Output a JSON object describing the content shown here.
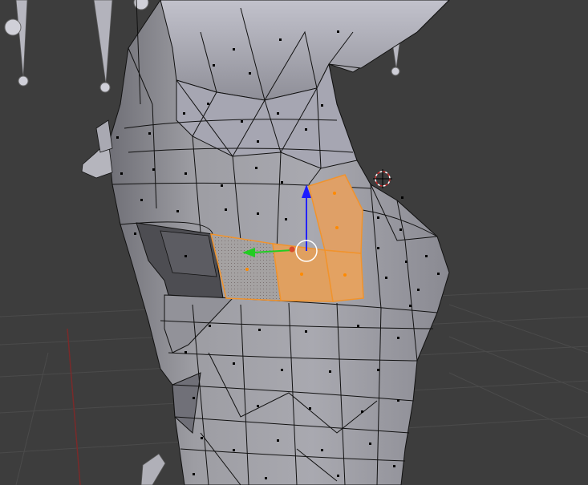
{
  "app": {
    "view": "3d-viewport",
    "mode": "edit-mode",
    "select_mode": "face"
  },
  "colors": {
    "background": "#3d3d3d",
    "grid": "#4a4a4a",
    "x_axis": "#8a2a2a",
    "mesh_fill": "#9d9da3",
    "mesh_fill_light": "#b9b9c2",
    "mesh_fill_dark": "#6f6f76",
    "wire": "#111111",
    "selection": "#f1932c",
    "selection_fill": "#e7a35c",
    "widget_z": "#1a1aff",
    "widget_y": "#22cc22",
    "widget_center": "#d84a2c",
    "cursor": "#d22a2a"
  },
  "icons": {
    "cursor_3d": "3d-cursor-icon",
    "transform_widget": "manipulator-widget-icon"
  }
}
